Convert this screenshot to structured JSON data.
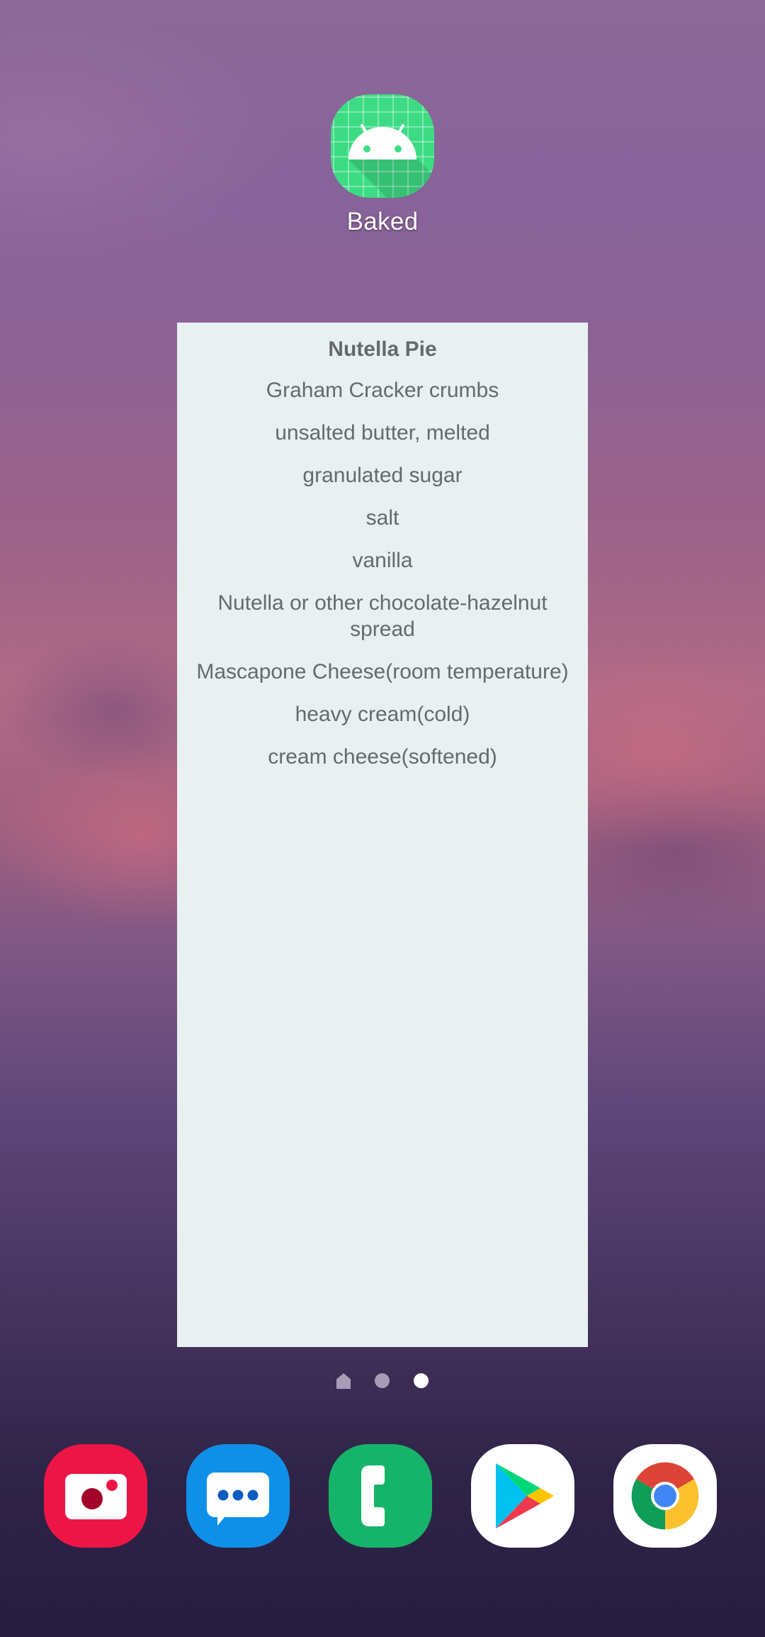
{
  "home_screen": {
    "app_shortcut": {
      "label": "Baked",
      "icon": "android-icon",
      "icon_color": "#3ddc84"
    },
    "widget": {
      "title": "Nutella Pie",
      "ingredients": [
        "Graham Cracker crumbs",
        "unsalted butter, melted",
        "granulated sugar",
        "salt",
        "vanilla",
        "Nutella or other chocolate-hazelnut spread",
        "Mascapone Cheese(room temperature)",
        "heavy cream(cold)",
        "cream cheese(softened)"
      ],
      "background_color": "#e8f0f2",
      "text_color": "#666a6c"
    },
    "page_indicator": {
      "pages": [
        "home",
        "page-2",
        "page-3"
      ],
      "active_index": 2
    },
    "dock": {
      "apps": [
        {
          "name": "Camera",
          "icon": "camera-icon",
          "color": "#ec1546"
        },
        {
          "name": "Messages",
          "icon": "messages-icon",
          "color": "#0f90e8"
        },
        {
          "name": "Phone",
          "icon": "phone-icon",
          "color": "#16b46a"
        },
        {
          "name": "Play Store",
          "icon": "play-store-icon",
          "color": "#ffffff"
        },
        {
          "name": "Chrome",
          "icon": "chrome-icon",
          "color": "#ffffff"
        }
      ]
    }
  }
}
